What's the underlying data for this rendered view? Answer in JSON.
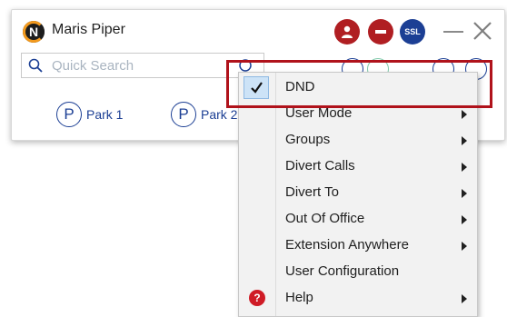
{
  "window": {
    "title": "Maris Piper",
    "logo_letter": "N",
    "ssl_label": "SSL",
    "status_color": "#b01e22",
    "accent": "#1c3f94"
  },
  "search": {
    "placeholder": "Quick Search"
  },
  "park": [
    {
      "label": "Park 1",
      "icon": "P"
    },
    {
      "label": "Park 2",
      "icon": "P"
    }
  ],
  "menu": {
    "items": [
      {
        "label": "DND",
        "checked": true,
        "submenu": false
      },
      {
        "label": "User Mode",
        "submenu": true
      },
      {
        "label": "Groups",
        "submenu": true
      },
      {
        "label": "Divert Calls",
        "submenu": true
      },
      {
        "label": "Divert To",
        "submenu": true
      },
      {
        "label": "Out Of Office",
        "submenu": true
      },
      {
        "label": "Extension Anywhere",
        "submenu": true
      },
      {
        "label": "User Configuration",
        "submenu": false
      },
      {
        "label": "Help",
        "submenu": true,
        "icon": "help-icon"
      }
    ],
    "highlight_color": "#b0121b"
  }
}
